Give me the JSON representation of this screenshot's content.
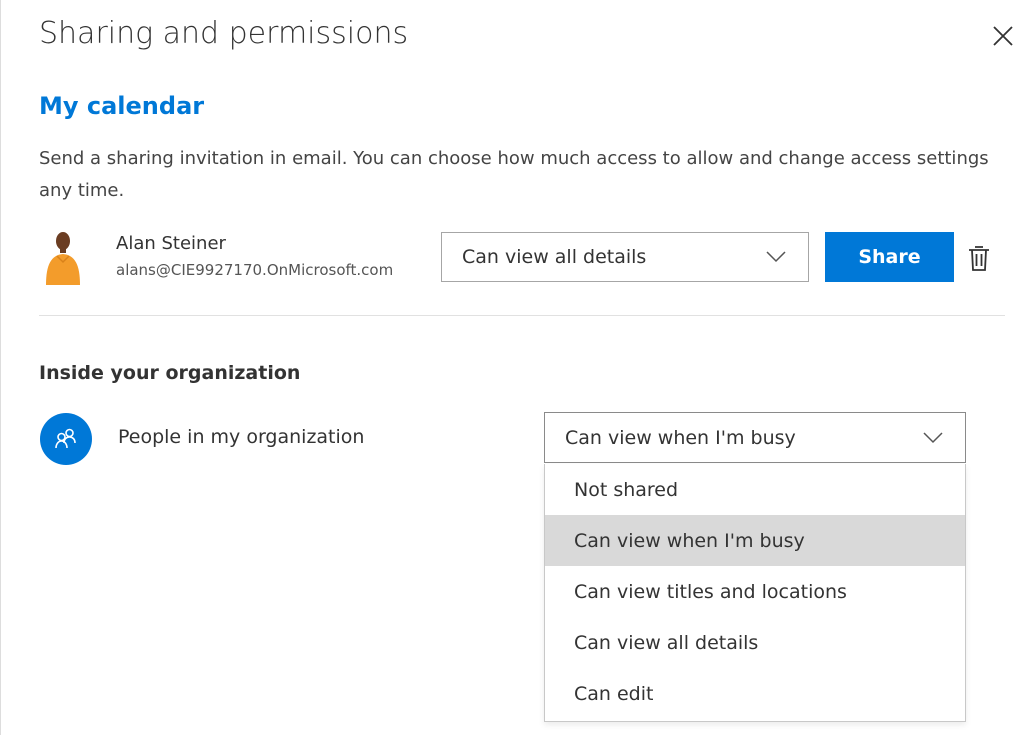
{
  "dialog": {
    "title": "Sharing and permissions",
    "calendar_name": "My calendar",
    "description": "Send a sharing invitation in email. You can choose how much access to allow and change access settings any time."
  },
  "invite": {
    "user_name": "Alan Steiner",
    "user_email": "alans@CIE9927170.OnMicrosoft.com",
    "permission_selected": "Can view all details",
    "share_label": "Share"
  },
  "organization": {
    "heading": "Inside your organization",
    "label": "People in my organization",
    "permission_selected": "Can view when I'm busy",
    "options": [
      "Not shared",
      "Can view when I'm busy",
      "Can view titles and locations",
      "Can view all details",
      "Can edit"
    ]
  },
  "icons": {
    "close": "close-icon",
    "chevron": "chevron-down-icon",
    "trash": "trash-icon",
    "people": "people-icon",
    "avatar": "user-avatar"
  },
  "colors": {
    "accent": "#0078d7",
    "selected_option_bg": "#d9d9d9"
  }
}
